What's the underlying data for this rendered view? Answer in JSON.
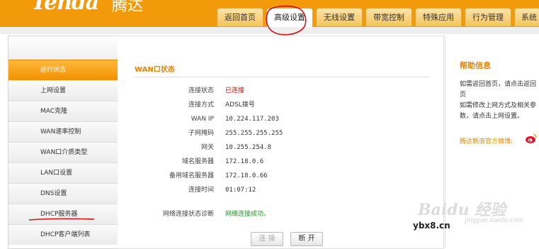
{
  "header": {
    "logo": "Tenda",
    "logo_cn": "腾达"
  },
  "tabs": [
    {
      "label": "返回首页"
    },
    {
      "label": "高级设置"
    },
    {
      "label": "无线设置"
    },
    {
      "label": "带宽控制"
    },
    {
      "label": "特殊应用"
    },
    {
      "label": "行为管理"
    },
    {
      "label": "系统"
    }
  ],
  "sidebar": {
    "items": [
      {
        "label": "运行状态",
        "active": true
      },
      {
        "label": "上网设置"
      },
      {
        "label": "MAC克隆"
      },
      {
        "label": "WAN速率控制"
      },
      {
        "label": "WAN口介质类型"
      },
      {
        "label": "LAN口设置"
      },
      {
        "label": "DNS设置"
      },
      {
        "label": "DHCP服务器"
      },
      {
        "label": "DHCP客户端列表"
      }
    ]
  },
  "wan": {
    "title": "WAN口状态",
    "rows": [
      {
        "label": "连接状态",
        "value": "已连接"
      },
      {
        "label": "连接方式",
        "value": "ADSL拨号"
      },
      {
        "label": "WAN IP",
        "value": "10.224.117.203"
      },
      {
        "label": "子网掩码",
        "value": "255.255.255.255"
      },
      {
        "label": "网关",
        "value": "10.255.254.8"
      },
      {
        "label": "域名服务器",
        "value": "172.18.0.6"
      },
      {
        "label": "备用域名服务器",
        "value": "172.18.0.66"
      },
      {
        "label": "连接时间",
        "value": "01:07:12"
      }
    ],
    "diag_label": "网络连接状态诊断",
    "diag_value": "网络连接成功。",
    "connect_btn": "连 接",
    "disconnect_btn": "断 开"
  },
  "help": {
    "title": "帮助信息",
    "lines": [
      "如需返回首页，请点击返回",
      "页",
      "如需修改上网方式及相关参",
      "数，请点击上网设置。"
    ],
    "weibo": "腾达新浪官方微博:"
  },
  "watermark": {
    "text": "Baidu 经验",
    "url": "jingyan.baidu.com",
    "site": "ybx8.cn"
  }
}
